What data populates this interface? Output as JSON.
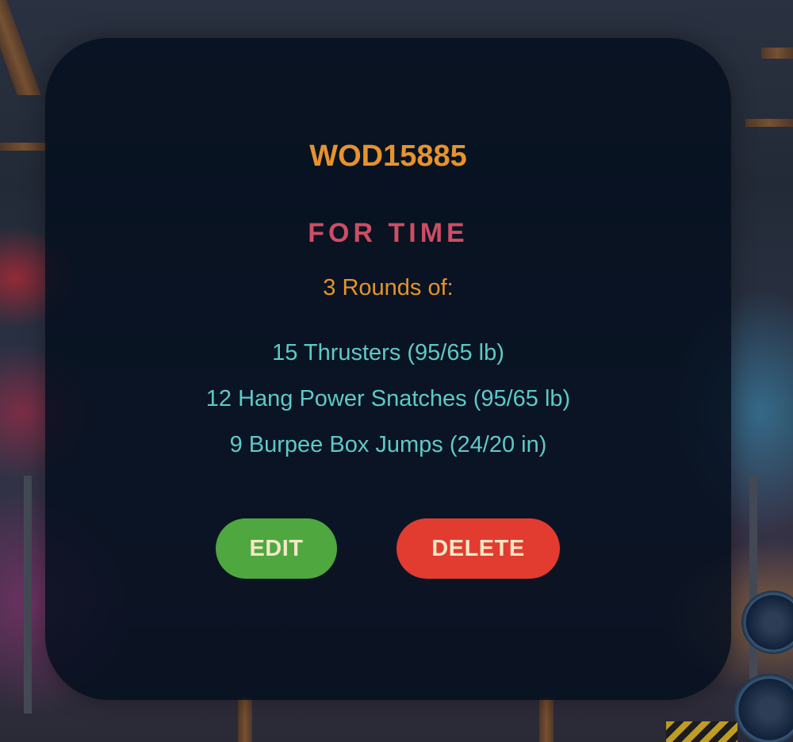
{
  "workout": {
    "title": "WOD15885",
    "type": "FOR TIME",
    "rounds_label": "3 Rounds of:",
    "movements": [
      "15 Thrusters (95/65 lb)",
      "12 Hang Power Snatches (95/65 lb)",
      "9 Burpee Box Jumps (24/20 in)"
    ]
  },
  "actions": {
    "edit_label": "EDIT",
    "delete_label": "DELETE"
  },
  "colors": {
    "title": "#e6932e",
    "type": "#cf4d64",
    "movement": "#5ec9c8",
    "edit_button": "#4ea83f",
    "delete_button": "#e23b30",
    "button_text": "#f4e7c6"
  }
}
